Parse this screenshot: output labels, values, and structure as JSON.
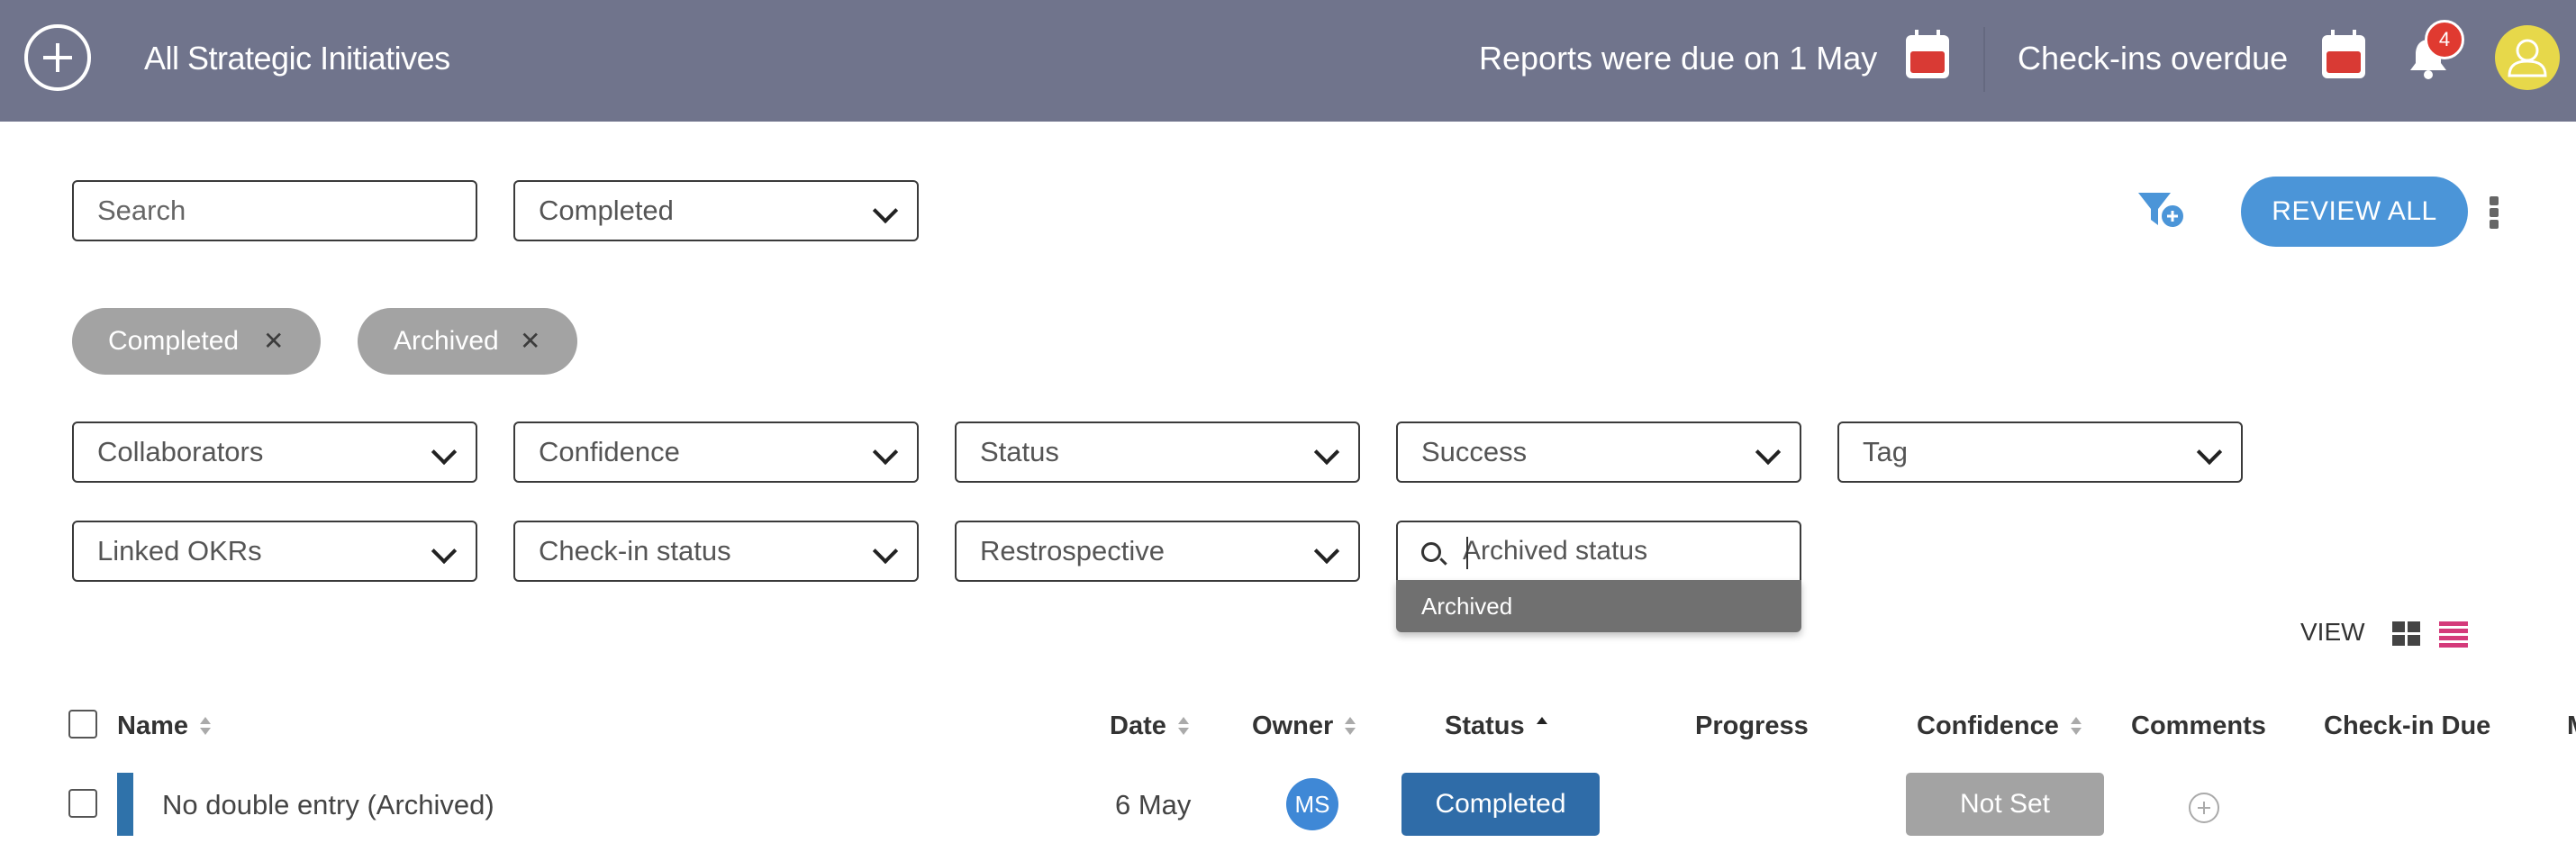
{
  "header": {
    "title": "All Strategic Initiatives",
    "reports_notice": "Reports were due on 1 May",
    "checkins_notice": "Check-ins overdue",
    "notification_count": "4"
  },
  "toolbar": {
    "search_placeholder": "Search",
    "status_filter": "Completed",
    "review_all": "REVIEW ALL"
  },
  "chips": [
    "Completed",
    "Archived"
  ],
  "filters": {
    "collaborators": "Collaborators",
    "confidence": "Confidence",
    "status": "Status",
    "success": "Success",
    "tag": "Tag",
    "linked_okrs": "Linked OKRs",
    "checkin_status": "Check-in status",
    "retrospective": "Restrospective",
    "archived_placeholder": "Archived status",
    "archived_option": "Archived"
  },
  "view": {
    "label": "VIEW"
  },
  "table": {
    "columns": {
      "name": "Name",
      "date": "Date",
      "owner": "Owner",
      "status": "Status",
      "progress": "Progress",
      "confidence": "Confidence",
      "comments": "Comments",
      "checkin_due": "Check-in Due",
      "more": "M"
    },
    "rows": [
      {
        "name": "No double entry (Archived)",
        "date": "6 May",
        "owner": "MS",
        "status": "Completed",
        "confidence": "Not Set"
      }
    ]
  },
  "colors": {
    "topbar": "#70748c",
    "primary": "#4b95d8",
    "status_completed": "#2f6ca8",
    "chip": "#a3a3a3",
    "alert": "#d93a34"
  }
}
